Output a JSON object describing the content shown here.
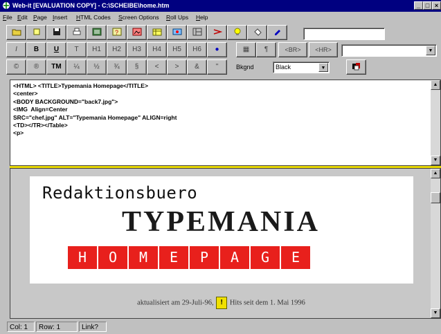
{
  "window": {
    "title": "Web-it [EVALUATION COPY] - C:\\SCHEIBE\\home.htm",
    "minimize": "_",
    "maximize": "□",
    "close": "×"
  },
  "menu": [
    "File",
    "Edit",
    "Page",
    "Insert",
    "HTML Codes",
    "Screen Options",
    "Roll Ups",
    "Help"
  ],
  "toolbar1": {
    "search_value": ""
  },
  "toolbar2": {
    "buttons": [
      "I",
      "B",
      "U",
      "T",
      "H1",
      "H2",
      "H3",
      "H4",
      "H5",
      "H6",
      "●",
      "▦",
      "¶",
      "<BR>",
      "<HR>"
    ],
    "tag_value": ""
  },
  "toolbar3": {
    "buttons": [
      "©",
      "®",
      "TM",
      "¼",
      "½",
      "¾",
      "§",
      "<",
      ">",
      "&",
      "\""
    ],
    "bkgnd_label": "Bkgnd",
    "bkgnd_value": "Black"
  },
  "editor": {
    "lines": [
      "<HTML> <TITLE>Typemania Homepage</TITLE>",
      "",
      "<center>",
      "<BODY BACKGROUND=\"back7.jpg\">",
      "<IMG  Align=Center",
      "SRC=\"chef.jpg\" ALT=\"Typemania Homepage\" ALIGN=right",
      "",
      "",
      "<TD></TR></Table>",
      "<p>"
    ]
  },
  "preview": {
    "line1": "Redaktionsbuero",
    "line2": "TYPEMANIA",
    "homepage_letters": [
      "H",
      "O",
      "M",
      "E",
      "P",
      "A",
      "G",
      "E"
    ],
    "footer_before": "aktualisiert am 29-Juli-96,",
    "counter_glyph": "!",
    "footer_after": "Hits seit dem 1. Mai 1996"
  },
  "status": {
    "col": "Col: 1",
    "row": "Row: 1",
    "link": "Link?"
  }
}
